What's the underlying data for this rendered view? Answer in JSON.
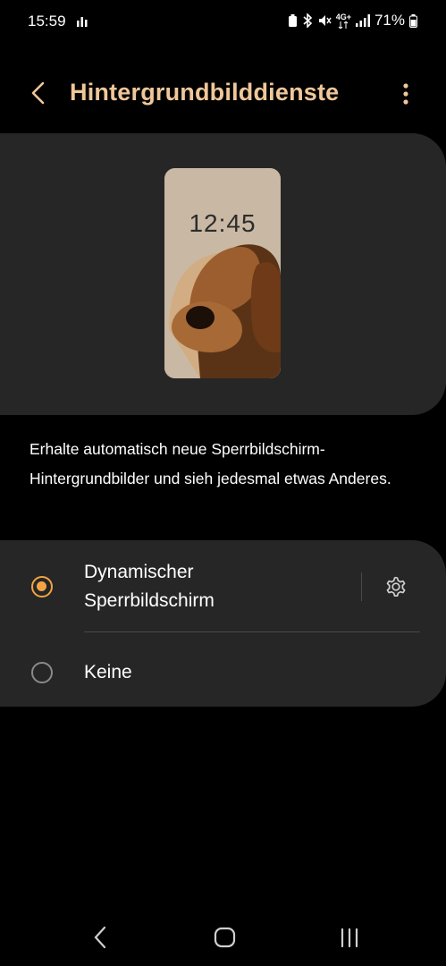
{
  "status_bar": {
    "time": "15:59",
    "network": "4G+",
    "battery": "71%"
  },
  "header": {
    "title": "Hintergrundbilddienste",
    "back_icon": "chevron-left-icon",
    "more_icon": "more-vertical-icon"
  },
  "preview": {
    "clock": "12:45"
  },
  "description": "Erhalte automatisch neue Sperrbildschirm-Hintergrundbilder und sieh jedesmal etwas Anderes.",
  "options": [
    {
      "line1": "Dynamischer",
      "line2": "Sperrbildschirm",
      "selected": true
    },
    {
      "line1": "Keine",
      "selected": false
    }
  ],
  "colors": {
    "accent": "#f0c79a",
    "radio": "#f2a444",
    "card": "#262626"
  },
  "nav_bar": {
    "back_icon": "back-icon",
    "home_icon": "home-icon",
    "recents_icon": "recents-icon"
  }
}
